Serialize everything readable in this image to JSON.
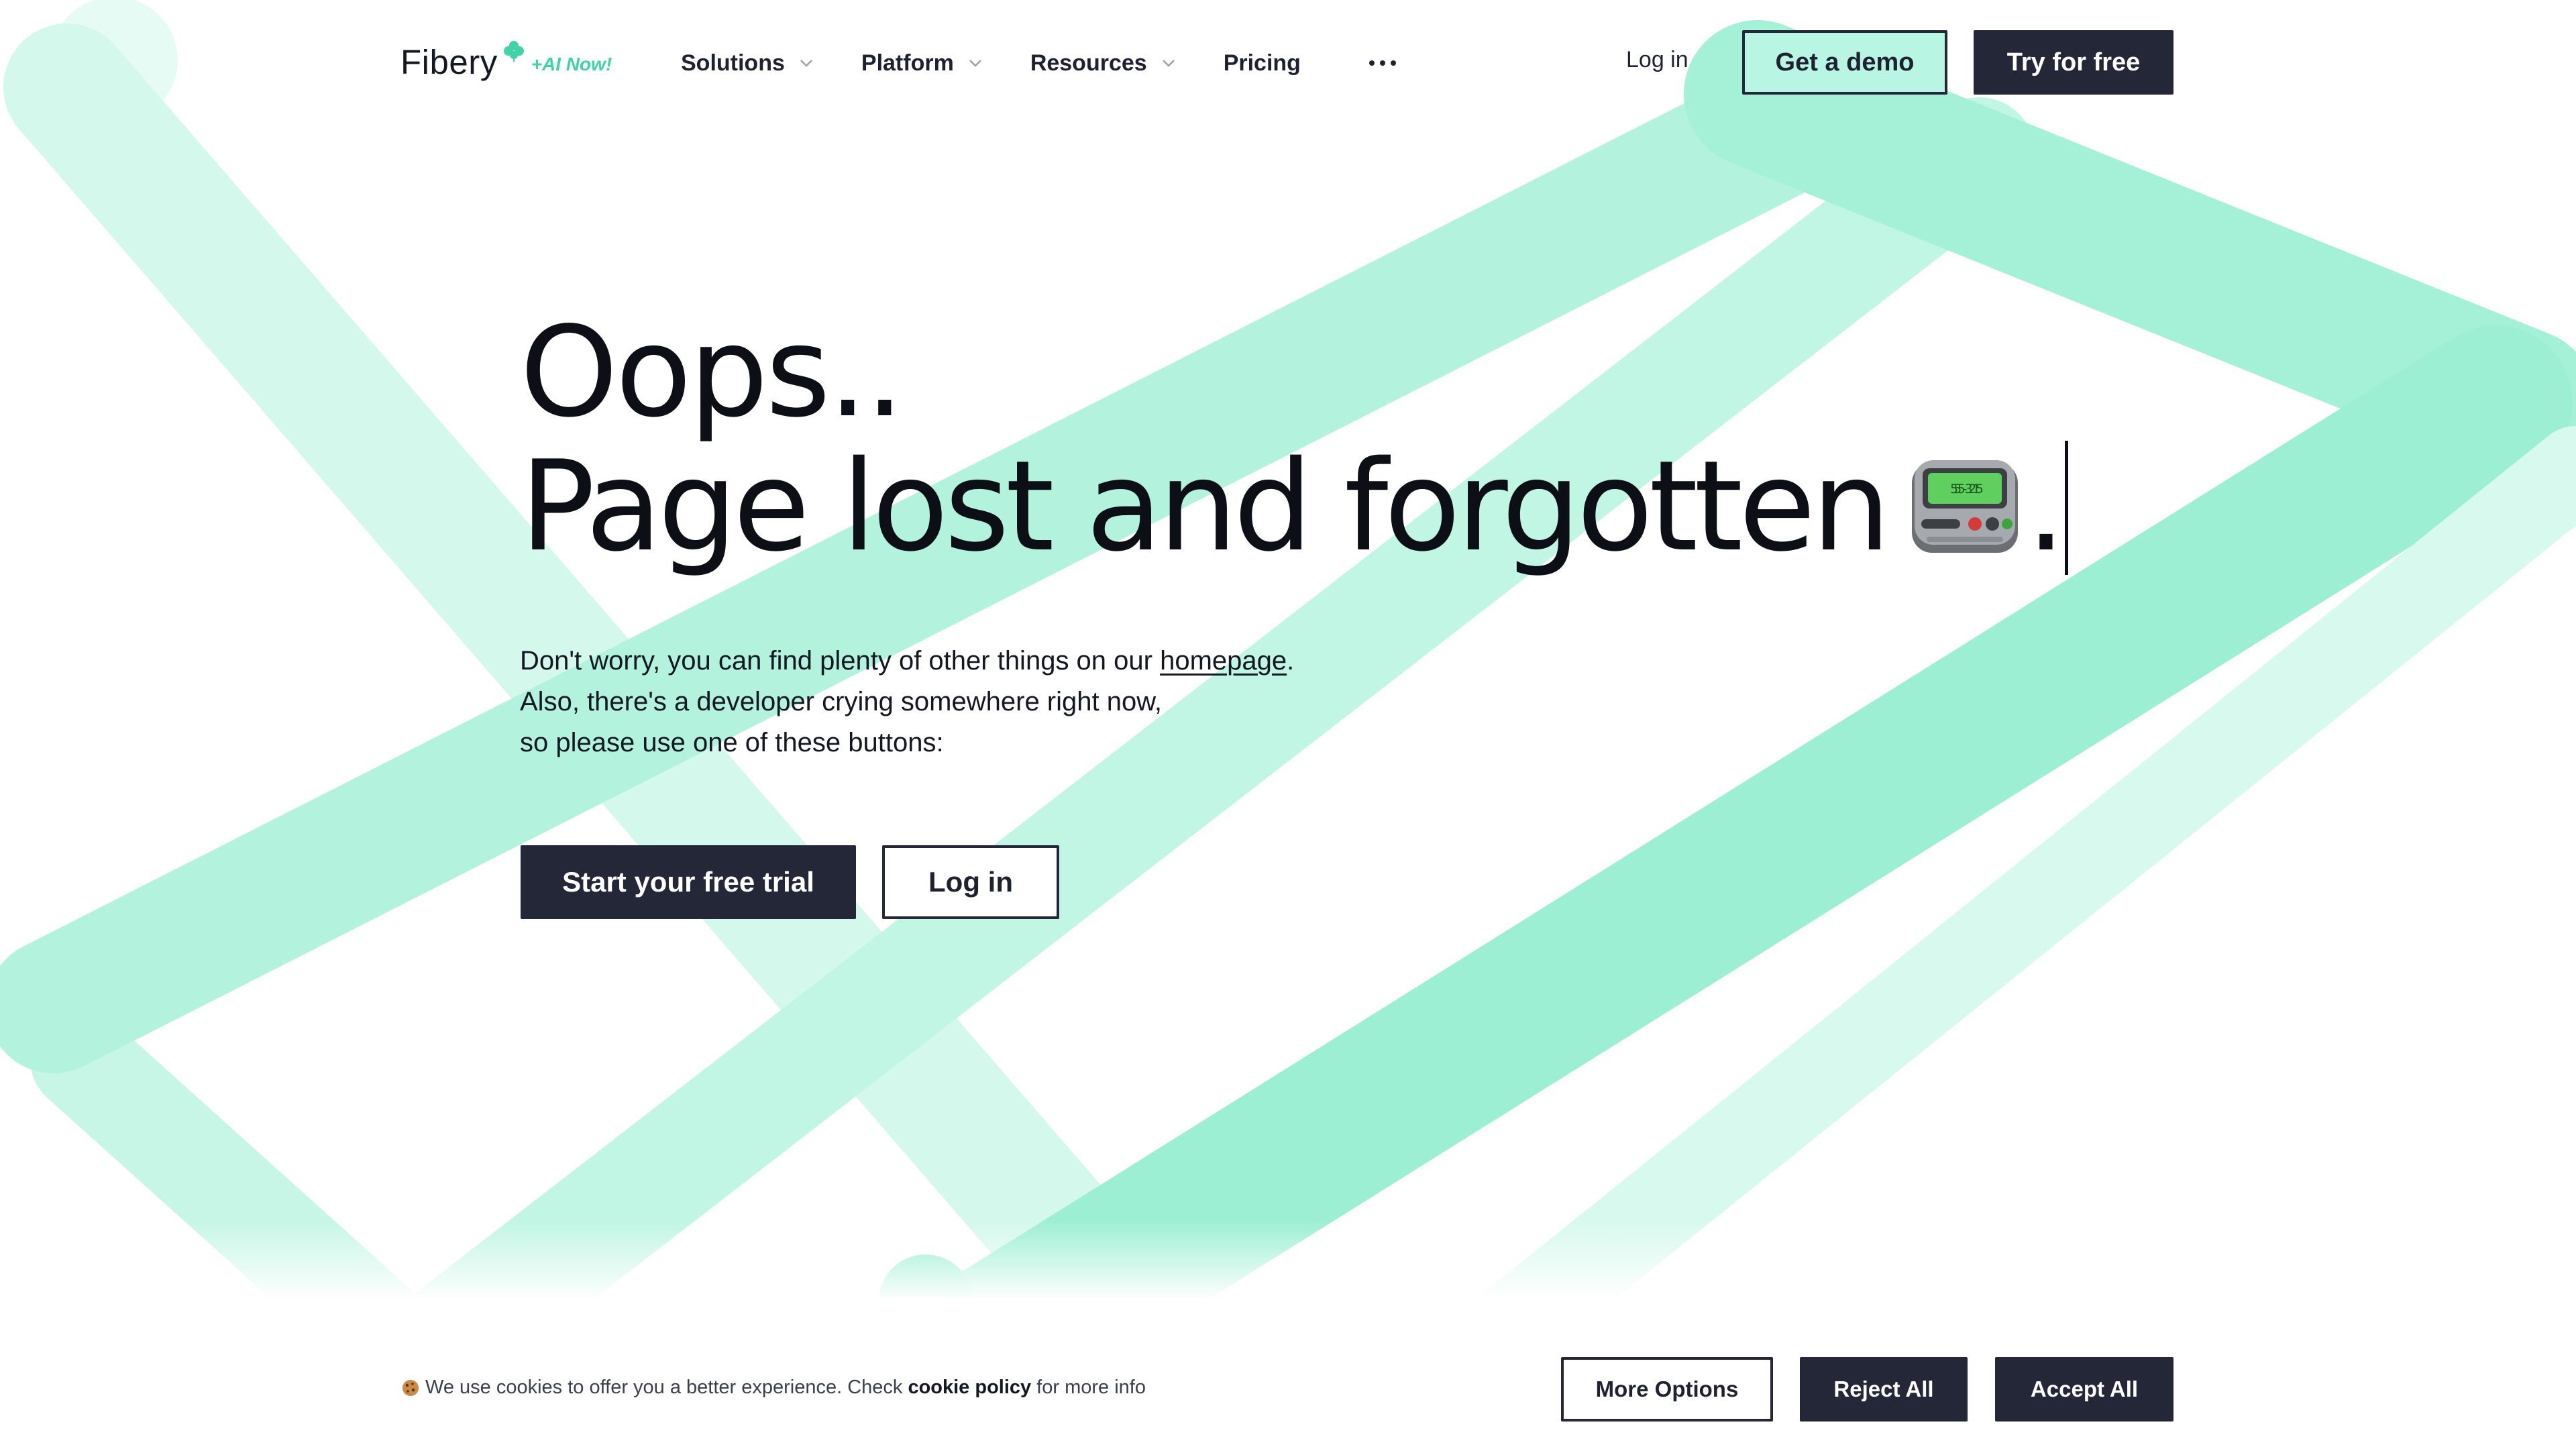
{
  "nav": {
    "logo_text": "Fibery",
    "logo_badge": "+AI Now!",
    "menu": [
      {
        "label": "Solutions",
        "has_dropdown": true
      },
      {
        "label": "Platform",
        "has_dropdown": true
      },
      {
        "label": "Resources",
        "has_dropdown": true
      },
      {
        "label": "Pricing",
        "has_dropdown": false
      }
    ],
    "more_icon": "more-dots-icon",
    "login_label": "Log in",
    "demo_label": "Get a demo",
    "try_label": "Try for free"
  },
  "hero": {
    "title_line1": "Oops..",
    "title_line2": "Page lost and forgotten",
    "title_end": ".",
    "pager_icon": "pager-icon",
    "pager_display": "555-3215",
    "text_line1_prefix": "Don't worry, you can find plenty of other things on our ",
    "text_line1_link": "homepage",
    "text_line1_suffix": ".",
    "text_line2": "Also, there's a developer crying somewhere right now,",
    "text_line3": "so please use one of these buttons:",
    "start_label": "Start your free trial",
    "login_label": "Log in"
  },
  "cookie": {
    "icon": "cookie-icon",
    "text_prefix": "We use cookies to offer you a better experience. Check",
    "policy_link": "cookie policy",
    "text_suffix": "for more info",
    "more_label": "More Options",
    "reject_label": "Reject All",
    "accept_label": "Accept All"
  },
  "colors": {
    "accent_mint": "#9ef0d6",
    "brand_dark": "#232738",
    "badge_green": "#3fd3a5"
  }
}
